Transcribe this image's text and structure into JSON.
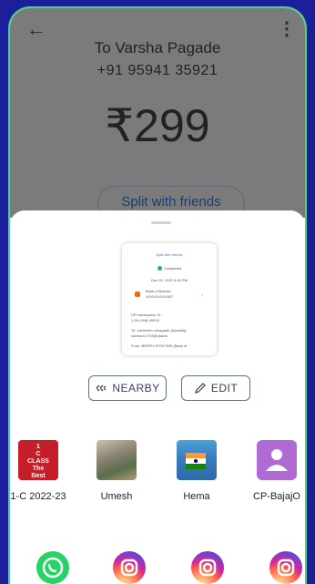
{
  "payment": {
    "payee": "To Varsha Pagade",
    "phone": "+91 95941 35921",
    "amount": "₹299",
    "split_label": "Split with friends"
  },
  "preview": {
    "title": "Split with friends",
    "status": "Completed",
    "date": "Dec 02, 2022 4:44 PM",
    "bank_name": "Bank of Baroda",
    "bank_account": "XXXXXXXX4307",
    "line1": "UPI transaction ID",
    "line2": "1-90-1948-49918",
    "line3": "To: vasheeleu.ninagade-@axisbtg",
    "line4": "varsha.tr1703@okaxis",
    "line5": "From: BEEPH-5TO27605 (Bank of"
  },
  "actions": {
    "nearby_label": "NEARBY",
    "edit_label": "EDIT"
  },
  "contacts": [
    {
      "name": "1-C 2022-23",
      "avatar_text": "1 C CLASS The Best"
    },
    {
      "name": "Umesh"
    },
    {
      "name": "Hema"
    },
    {
      "name": "CP-BajajO"
    }
  ],
  "apps": [
    "whatsapp-icon",
    "instagram-icon",
    "instagram-icon",
    "instagram-icon"
  ],
  "colors": {
    "frame_border": "#4fd18a",
    "background": "#1b1f9a",
    "accent": "#1c3c78"
  }
}
